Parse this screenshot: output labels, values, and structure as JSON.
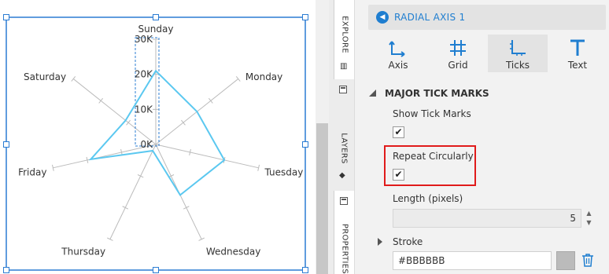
{
  "chart_data": {
    "type": "radar",
    "categories": [
      "Sunday",
      "Monday",
      "Tuesday",
      "Wednesday",
      "Thursday",
      "Friday",
      "Saturday"
    ],
    "values": [
      21000,
      15000,
      20000,
      16000,
      2000,
      19000,
      11000
    ],
    "radial_ticks": [
      "0K",
      "10K",
      "20K",
      "30K"
    ],
    "rmax": 30000,
    "series_color": "#5bc8f0",
    "axis_color": "#BBBBBB"
  },
  "panel": {
    "breadcrumb": "RADIAL AXIS 1",
    "tabs": [
      {
        "label": "Axis",
        "icon": "axis-icon"
      },
      {
        "label": "Grid",
        "icon": "grid-icon"
      },
      {
        "label": "Ticks",
        "icon": "ticks-icon"
      },
      {
        "label": "Text",
        "icon": "text-icon"
      }
    ],
    "section": "MAJOR TICK MARKS",
    "show_tick_marks_label": "Show Tick Marks",
    "show_tick_marks_checked": "✔",
    "repeat_label": "Repeat Circularly",
    "repeat_checked": "✔",
    "length_label": "Length (pixels)",
    "length_value": "5",
    "spin_up": "▲",
    "spin_down": "▼",
    "stroke_label": "Stroke",
    "stroke_value": "#BBBBBB",
    "stroke_color": "#BBBBBB"
  },
  "side_tabs": {
    "explore": "EXPLORE",
    "layers": "LAYERS",
    "properties": "PROPERTIES"
  },
  "accent_color": "#1f7ed0",
  "highlight_color": "#e01b1b"
}
